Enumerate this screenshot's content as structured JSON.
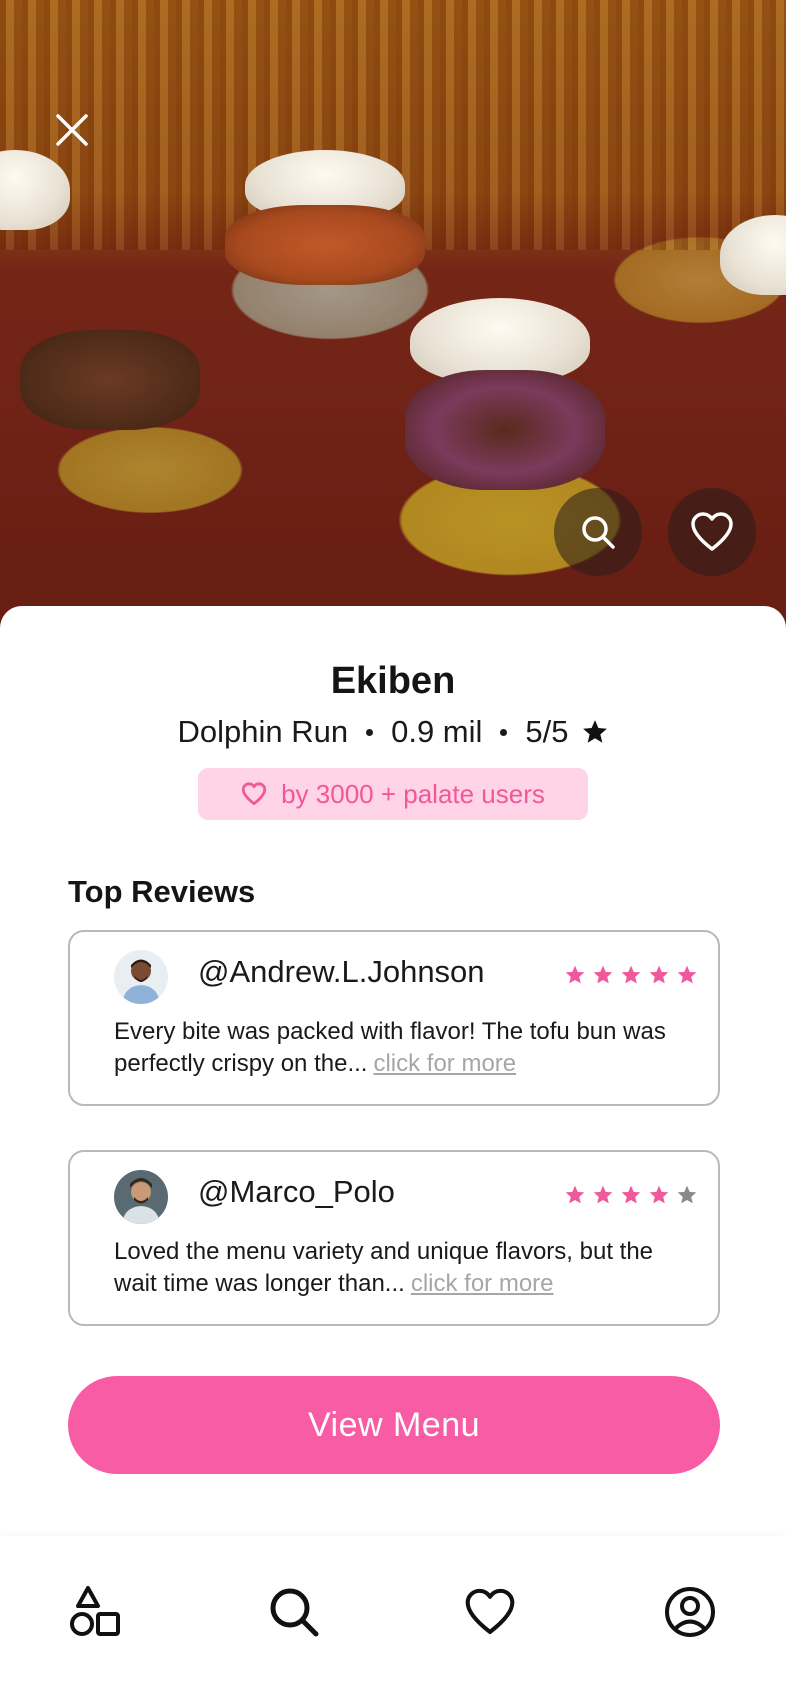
{
  "restaurant": {
    "name": "Ekiben",
    "neighborhood": "Dolphin Run",
    "distance": "0.9 mil",
    "rating": "5/5"
  },
  "badge": {
    "text": "by 3000 + palate users"
  },
  "reviews_section": {
    "heading": "Top Reviews",
    "items": [
      {
        "handle": "@Andrew.L.Johnson",
        "rating": 5,
        "text": "Every bite was packed with flavor! The tofu bun was perfectly crispy on the...",
        "more": "click for more"
      },
      {
        "handle": "@Marco_Polo",
        "rating": 4,
        "text": "Loved the menu variety and unique flavors, but the wait time was longer than...",
        "more": "click for more"
      }
    ]
  },
  "actions": {
    "view_menu": "View Menu"
  },
  "nav": {
    "items": [
      "shapes-icon",
      "search-icon",
      "heart-icon",
      "profile-icon"
    ]
  },
  "colors": {
    "accent": "#f75ca5",
    "badge_bg": "#ffd4e6",
    "star_pink": "#f0589b",
    "star_gray": "#8a8a8a"
  }
}
